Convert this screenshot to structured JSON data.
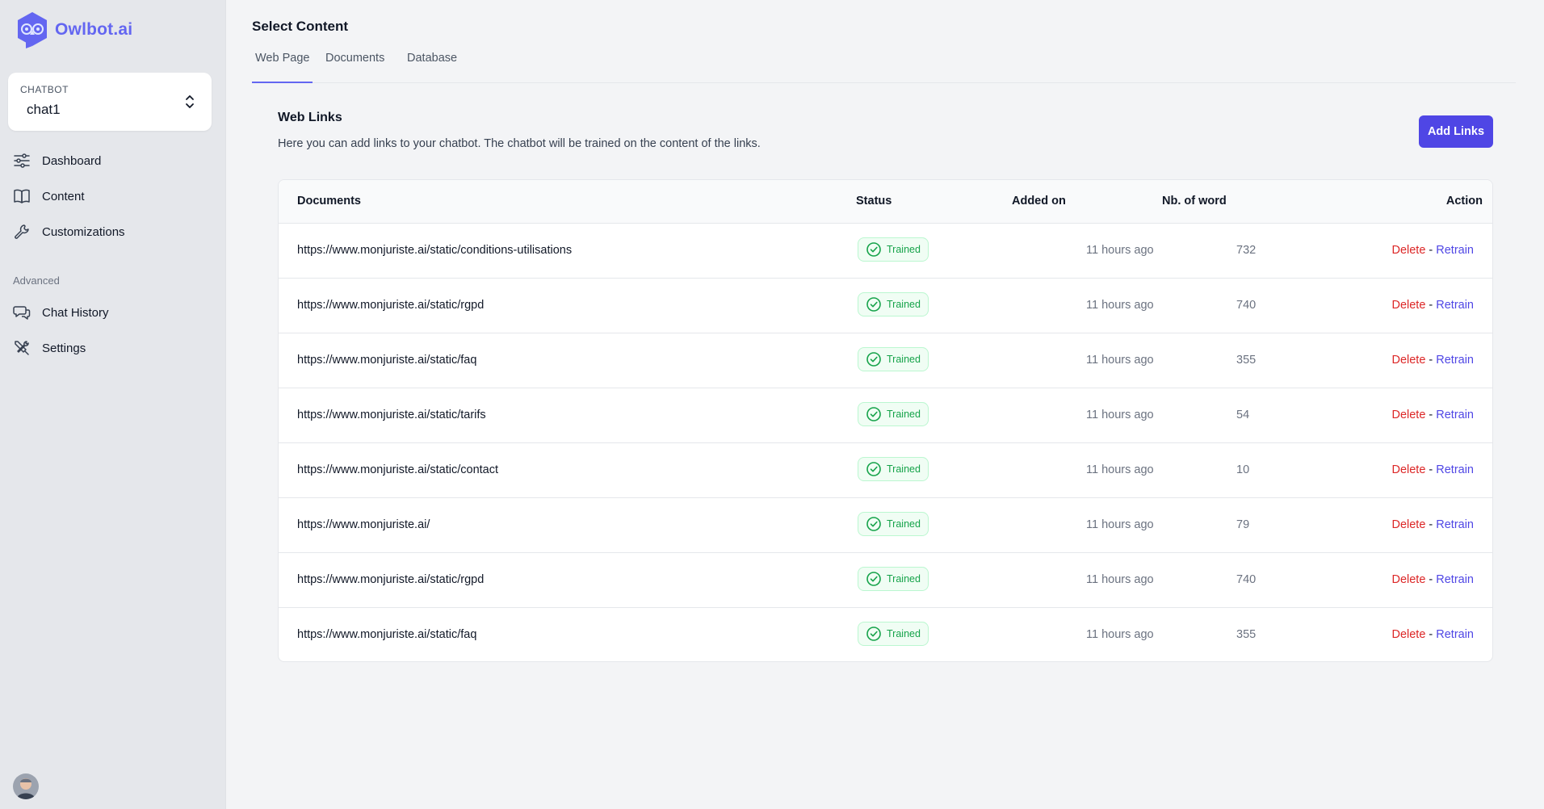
{
  "app": {
    "name": "Owlbot.ai",
    "brand_color": "#6366f1"
  },
  "sidebar": {
    "chatbot_select": {
      "caption": "CHATBOT",
      "value": "chat1"
    },
    "items": [
      {
        "label": "Dashboard",
        "icon": "sliders-icon"
      },
      {
        "label": "Content",
        "icon": "book-icon"
      },
      {
        "label": "Customizations",
        "icon": "wrench-icon"
      }
    ],
    "advanced_label": "Advanced",
    "advanced_items": [
      {
        "label": "Chat History",
        "icon": "chat-bubbles-icon"
      },
      {
        "label": "Settings",
        "icon": "tools-icon"
      }
    ]
  },
  "main": {
    "title": "Select Content",
    "tabs": [
      {
        "label": "Web Page",
        "active": true
      },
      {
        "label": "Documents",
        "active": false
      },
      {
        "label": "Database",
        "active": false
      }
    ],
    "section": {
      "title": "Web Links",
      "description": "Here you can add links to your chatbot. The chatbot will be trained on the content of the links.",
      "add_button": "Add Links"
    },
    "table": {
      "columns": [
        "Documents",
        "Status",
        "Added on",
        "Nb. of word",
        "Action"
      ],
      "delete_label": "Delete",
      "separator": "-",
      "retrain_label": "Retrain",
      "status_color": "#16a34a",
      "rows": [
        {
          "document": "https://www.monjuriste.ai/static/conditions-utilisations",
          "status": "Trained",
          "added": "11 hours ago",
          "words": "732"
        },
        {
          "document": "https://www.monjuriste.ai/static/rgpd",
          "status": "Trained",
          "added": "11 hours ago",
          "words": "740"
        },
        {
          "document": "https://www.monjuriste.ai/static/faq",
          "status": "Trained",
          "added": "11 hours ago",
          "words": "355"
        },
        {
          "document": "https://www.monjuriste.ai/static/tarifs",
          "status": "Trained",
          "added": "11 hours ago",
          "words": "54"
        },
        {
          "document": "https://www.monjuriste.ai/static/contact",
          "status": "Trained",
          "added": "11 hours ago",
          "words": "10"
        },
        {
          "document": "https://www.monjuriste.ai/",
          "status": "Trained",
          "added": "11 hours ago",
          "words": "79"
        },
        {
          "document": "https://www.monjuriste.ai/static/rgpd",
          "status": "Trained",
          "added": "11 hours ago",
          "words": "740"
        },
        {
          "document": "https://www.monjuriste.ai/static/faq",
          "status": "Trained",
          "added": "11 hours ago",
          "words": "355"
        }
      ]
    }
  }
}
